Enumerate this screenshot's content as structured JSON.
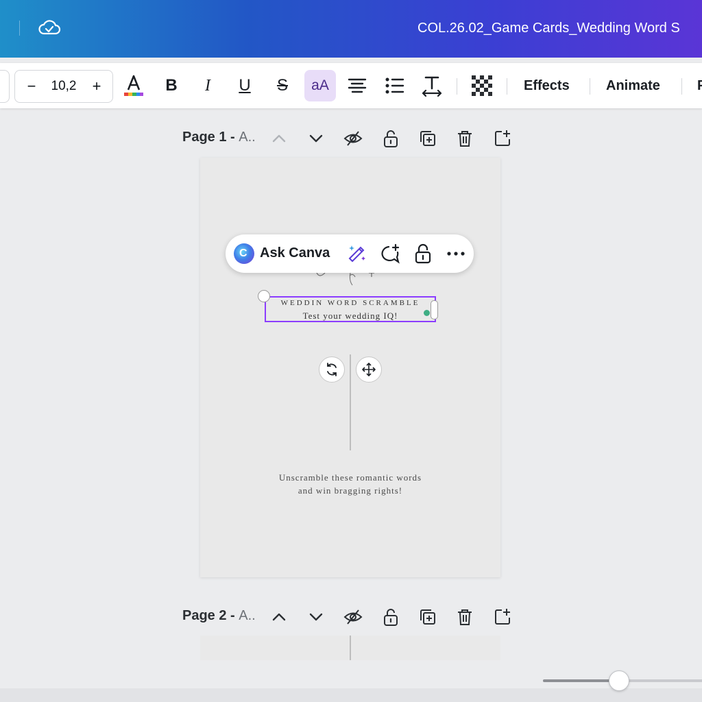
{
  "header": {
    "doc_title": "COL.26.02_Game Cards_Wedding Word S"
  },
  "toolbar": {
    "font_size_minus": "−",
    "font_size": "10,2",
    "font_size_plus": "+",
    "bold_label": "B",
    "italic_label": "I",
    "underline_label": "U",
    "strike_label": "S",
    "case_label": "aA",
    "effects_label": "Effects",
    "animate_label": "Animate",
    "overflow_label": "P",
    "text_color": "#1b1f24"
  },
  "pages": [
    {
      "title": "Page 1 - ",
      "subtitle": "A.."
    },
    {
      "title": "Page 2 - ",
      "subtitle": "A.."
    }
  ],
  "ask_canva": {
    "label": "Ask Canva"
  },
  "design": {
    "title_line": "WEDDIN WORD SCRAMBLE",
    "subtitle_line": "Test your wedding IQ!",
    "body_line1": "Unscramble these romantic words",
    "body_line2": "and win bragging rights!"
  },
  "zoom": {
    "level_fraction": 0.46
  },
  "colors": {
    "selection": "#8b3dff",
    "accent_active": "#e8ddf8",
    "header_gradient_start": "#1f8fc9",
    "header_gradient_end": "#5a35d6"
  }
}
